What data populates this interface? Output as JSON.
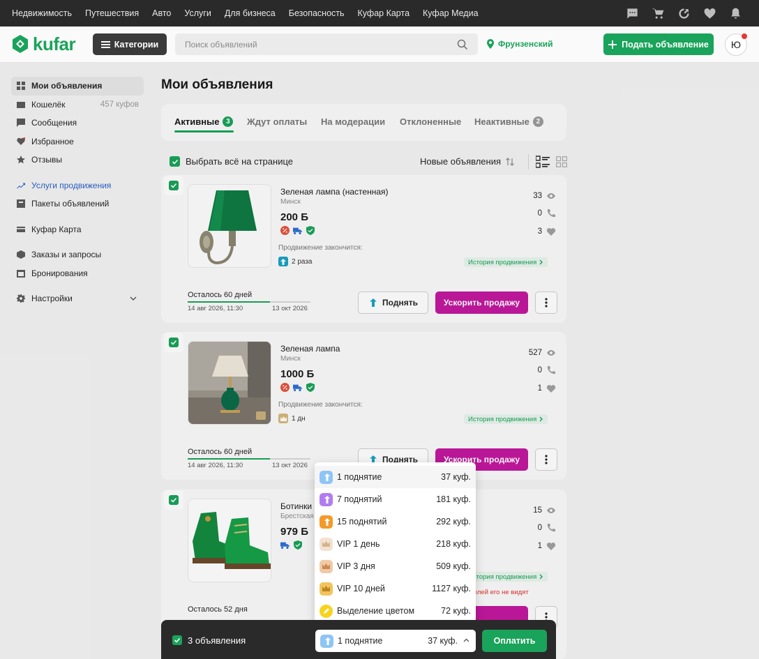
{
  "topbar": {
    "links": [
      "Недвижимость",
      "Путешествия",
      "Авто",
      "Услуги",
      "Для бизнеса",
      "Безопасность",
      "Куфар Карта",
      "Куфар Медиа"
    ],
    "icons": [
      "chat-icon",
      "cart-icon",
      "compare-icon",
      "heart-icon",
      "bell-icon"
    ]
  },
  "header": {
    "logo_text": "kufar",
    "categories_label": "Категории",
    "search_placeholder": "Поиск объявлений",
    "location": "Фрунзенский",
    "post_label": "Подать объявление",
    "avatar_letter": "Ю",
    "brand_color": "#1aa35a"
  },
  "sidebar": {
    "items": [
      {
        "label": "Мои объявления",
        "icon": "grid-icon"
      },
      {
        "label": "Кошелёк",
        "badge": "457 куфов",
        "icon": "wallet-icon"
      },
      {
        "label": "Сообщения",
        "icon": "message-icon"
      },
      {
        "label": "Избранное",
        "icon": "heart-icon"
      },
      {
        "label": "Отзывы",
        "icon": "star-icon"
      },
      {
        "label": "Услуги продвижения",
        "icon": "trending-icon"
      },
      {
        "label": "Пакеты объявлений",
        "icon": "package-icon"
      },
      {
        "label": "Куфар Карта",
        "icon": "card-icon"
      },
      {
        "label": "Заказы и запросы",
        "icon": "box-icon"
      },
      {
        "label": "Бронирования",
        "icon": "calendar-icon"
      },
      {
        "label": "Настройки",
        "icon": "gear-icon"
      }
    ]
  },
  "main": {
    "title": "Мои объявления",
    "tabs": [
      {
        "label": "Активные",
        "count": "3"
      },
      {
        "label": "Ждут оплаты"
      },
      {
        "label": "На модерации"
      },
      {
        "label": "Отклоненные"
      },
      {
        "label": "Неактивные",
        "count": "2"
      }
    ],
    "select_all": "Выбрать всё на странице",
    "sort": "Новые объявления"
  },
  "listings": [
    {
      "title": "Зеленая лампа (настенная)",
      "city": "Минск",
      "price": "200 Б",
      "views": "33",
      "calls": "0",
      "favs": "3",
      "promo_label": "Продвижение закончится:",
      "promo_value": "2 раза",
      "history": "История продвижения",
      "remaining": "Осталось 60 дней",
      "progress": 0.67,
      "date_from": "14 авг 2026, 11:30",
      "date_to": "13 окт 2026",
      "raise_label": "Поднять",
      "boost_label": "Ускорить продажу"
    },
    {
      "title": "Зеленая лампа",
      "city": "Минск",
      "price": "1000 Б",
      "views": "527",
      "calls": "0",
      "favs": "1",
      "promo_label": "Продвижение закончится:",
      "promo_value": "1 дн",
      "history": "История продвижения",
      "remaining": "Осталось 60 дней",
      "progress": 0.67,
      "date_from": "14 авг 2026, 11:30",
      "date_to": "13 окт 2026",
      "raise_label": "Поднять",
      "boost_label": "Ускорить продажу"
    },
    {
      "title": "Ботинки",
      "city": "Брестская",
      "price": "979 Б",
      "views": "15",
      "calls": "0",
      "favs": "1",
      "history": "История продвижения",
      "warning": "покупателей его не видят",
      "remaining": "Осталось 52 дня"
    }
  ],
  "promo_options": [
    {
      "name": "1 поднятие",
      "price": "37 куф.",
      "color": "#8ec5f5",
      "icon": "raise-icon"
    },
    {
      "name": "7 поднятий",
      "price": "181 куф.",
      "color": "#b27cf0",
      "icon": "raise-icon"
    },
    {
      "name": "15 поднятий",
      "price": "292 куф.",
      "color": "#f59a2a",
      "icon": "raise-icon"
    },
    {
      "name": "VIP 1 день",
      "price": "218 куф.",
      "color": "#f3e2d2",
      "icon": "crown-icon"
    },
    {
      "name": "VIP 3 дня",
      "price": "509 куф.",
      "color": "#f2c9a5",
      "icon": "crown-icon"
    },
    {
      "name": "VIP 10 дней",
      "price": "1127 куф.",
      "color": "#f1c45c",
      "icon": "crown-icon"
    },
    {
      "name": "Выделение цветом",
      "price": "72 куф.",
      "color": "#f7d31e",
      "icon": "highlight-icon"
    }
  ],
  "bottom_bar": {
    "count_label": "3 объявления",
    "selected_name": "1 поднятие",
    "selected_price": "37 куф.",
    "pay_label": "Оплатить"
  }
}
